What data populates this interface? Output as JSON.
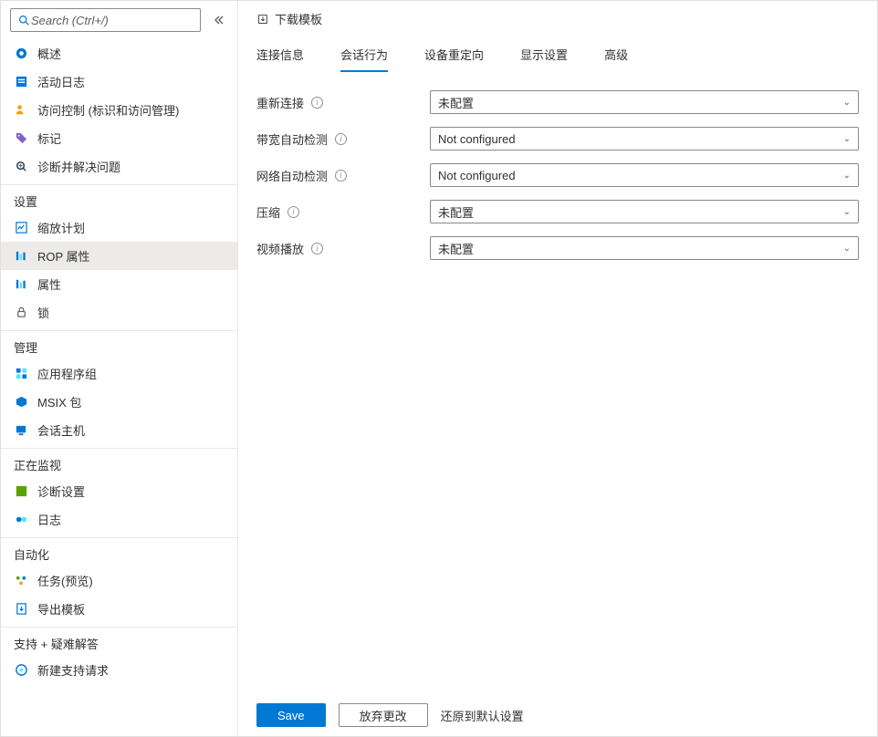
{
  "search": {
    "placeholder": "Search (Ctrl+/)"
  },
  "sidebar": {
    "items": [
      {
        "icon": "overview",
        "label": "概述"
      },
      {
        "icon": "log",
        "label": "活动日志"
      },
      {
        "icon": "access",
        "label": "访问控制 (标识和访问管理)"
      },
      {
        "icon": "tag",
        "label": "标记"
      },
      {
        "icon": "diagnose",
        "label": "诊断并解决问题"
      }
    ],
    "sections": {
      "settings": {
        "title": "设置",
        "items": [
          {
            "icon": "scaling",
            "label": "缩放计划"
          },
          {
            "icon": "rdp",
            "label": "ROP 属性",
            "selected": true
          },
          {
            "icon": "props",
            "label": "属性"
          },
          {
            "icon": "lock",
            "label": "锁"
          }
        ]
      },
      "manage": {
        "title": "管理",
        "items": [
          {
            "icon": "appgroup",
            "label": "应用程序组"
          },
          {
            "icon": "msix",
            "label": "MSIX 包"
          },
          {
            "icon": "session",
            "label": "会话主机"
          }
        ]
      },
      "monitor": {
        "title": "正在监视",
        "items": [
          {
            "icon": "diag",
            "label": "诊断设置"
          },
          {
            "icon": "logs",
            "label": "日志"
          }
        ]
      },
      "automation": {
        "title": "自动化",
        "items": [
          {
            "icon": "tasks",
            "label": "任务(预览)"
          },
          {
            "icon": "export",
            "label": "导出模板"
          }
        ]
      },
      "support": {
        "title": "支持 + 疑难解答",
        "items": [
          {
            "icon": "support",
            "label": "新建支持请求"
          }
        ]
      }
    }
  },
  "toolbar": {
    "download": "下载模板"
  },
  "tabs": {
    "connection": "连接信息",
    "session": "会话行为",
    "device": "设备重定向",
    "display": "显示设置",
    "advanced": "高级"
  },
  "form": {
    "rows": [
      {
        "label": "重新连接",
        "value": "未配置"
      },
      {
        "label": "带宽自动检测",
        "value": "Not configured"
      },
      {
        "label": "网络自动检测",
        "value": "Not configured"
      },
      {
        "label": "压缩",
        "value": "未配置"
      },
      {
        "label": "视频播放",
        "value": "未配置"
      }
    ]
  },
  "footer": {
    "save": "Save",
    "discard": "放弃更改",
    "restore": "还原到默认设置"
  }
}
